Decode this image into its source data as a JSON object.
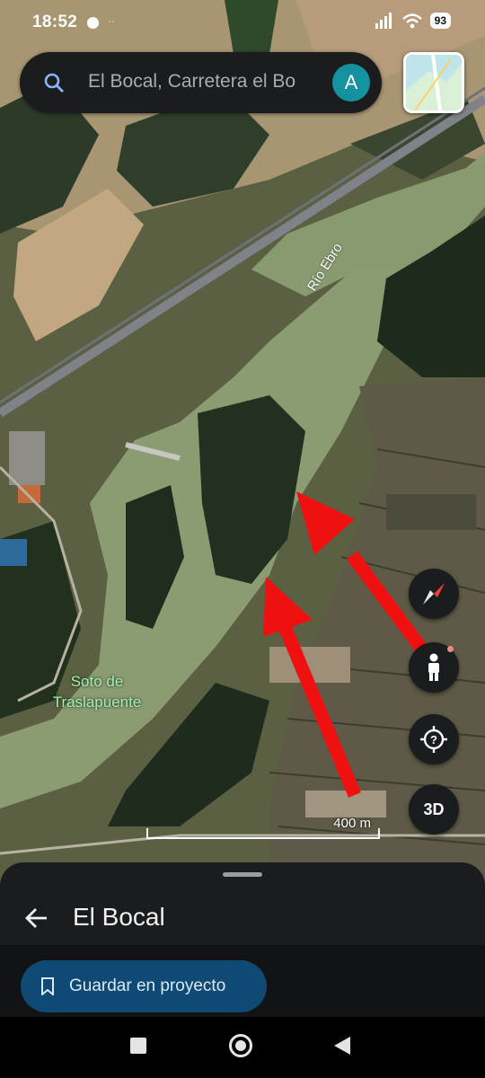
{
  "status_bar": {
    "time": "18:52",
    "battery": "93"
  },
  "search": {
    "text": "El Bocal, Carretera el Bo",
    "avatar_letter": "A"
  },
  "map": {
    "labels": {
      "river": "Río Ebro",
      "place": "Soto de Traslapuente"
    },
    "scale": "400 m"
  },
  "buttons": {
    "three_d": "3D"
  },
  "sheet": {
    "title": "El Bocal",
    "save_label": "Guardar en proyecto"
  },
  "colors": {
    "annotation_arrow": "#f01010",
    "fab_background": "#1b1c1e",
    "save_button": "#0e4a73",
    "avatar": "#1592a0"
  },
  "icons": [
    "search-icon",
    "compass-icon",
    "pegman-icon",
    "locate-icon",
    "back-arrow-icon",
    "bookmark-icon"
  ]
}
